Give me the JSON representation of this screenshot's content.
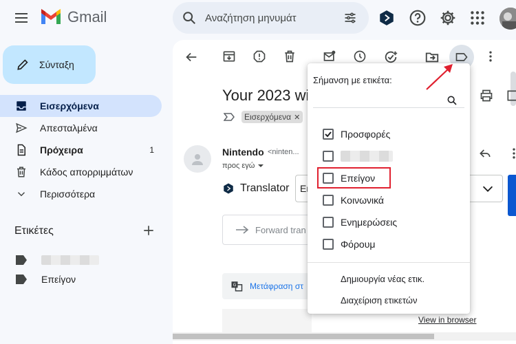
{
  "app": {
    "name": "Gmail"
  },
  "search": {
    "placeholder": "Αναζήτηση μηνυμάτ"
  },
  "nav": {
    "compose": "Σύνταξη",
    "items": [
      {
        "label": "Εισερχόμενα",
        "count": "",
        "active": true
      },
      {
        "label": "Απεσταλμένα",
        "count": ""
      },
      {
        "label": "Πρόχειρα",
        "count": "1"
      },
      {
        "label": "Κάδος απορριμμάτων",
        "count": ""
      },
      {
        "label": "Περισσότερα",
        "count": ""
      }
    ],
    "labels_title": "Ετικέτες",
    "labels": [
      "",
      "Επείγον"
    ]
  },
  "email": {
    "subject": "Your 2023 wi",
    "inbox_chip": "Εισερχόμενα",
    "sender": "Nintendo",
    "sender_email": "<ninten...",
    "recipient": "προς εγώ",
    "translator": "Translator",
    "lang_value": "Ει",
    "forward": "Forward tran",
    "translate_link": "Μετάφραση στ",
    "view_browser": "View in browser"
  },
  "label_menu": {
    "title": "Σήμανση με ετικέτα:",
    "search_value": "",
    "options": [
      {
        "label": "Προσφορές",
        "checked": true
      },
      {
        "label": "",
        "checked": false,
        "redacted": true
      },
      {
        "label": "Επείγον",
        "checked": false,
        "highlighted": true
      },
      {
        "label": "Κοινωνικά",
        "checked": false
      },
      {
        "label": "Ενημερώσεις",
        "checked": false
      },
      {
        "label": "Φόρουμ",
        "checked": false
      }
    ],
    "create_label": "Δημιουργία νέας ετικ.",
    "manage_labels": "Διαχείριση ετικετών"
  },
  "colors": {
    "accent": "#0b57d0",
    "compose_bg": "#c2e7ff",
    "active_nav": "#d3e3fd",
    "highlight": "#e0202f"
  },
  "icons": [
    "menu-icon",
    "gmail-logo-icon",
    "search-icon",
    "tune-icon",
    "extension-icon",
    "help-icon",
    "settings-icon",
    "apps-icon",
    "avatar"
  ]
}
